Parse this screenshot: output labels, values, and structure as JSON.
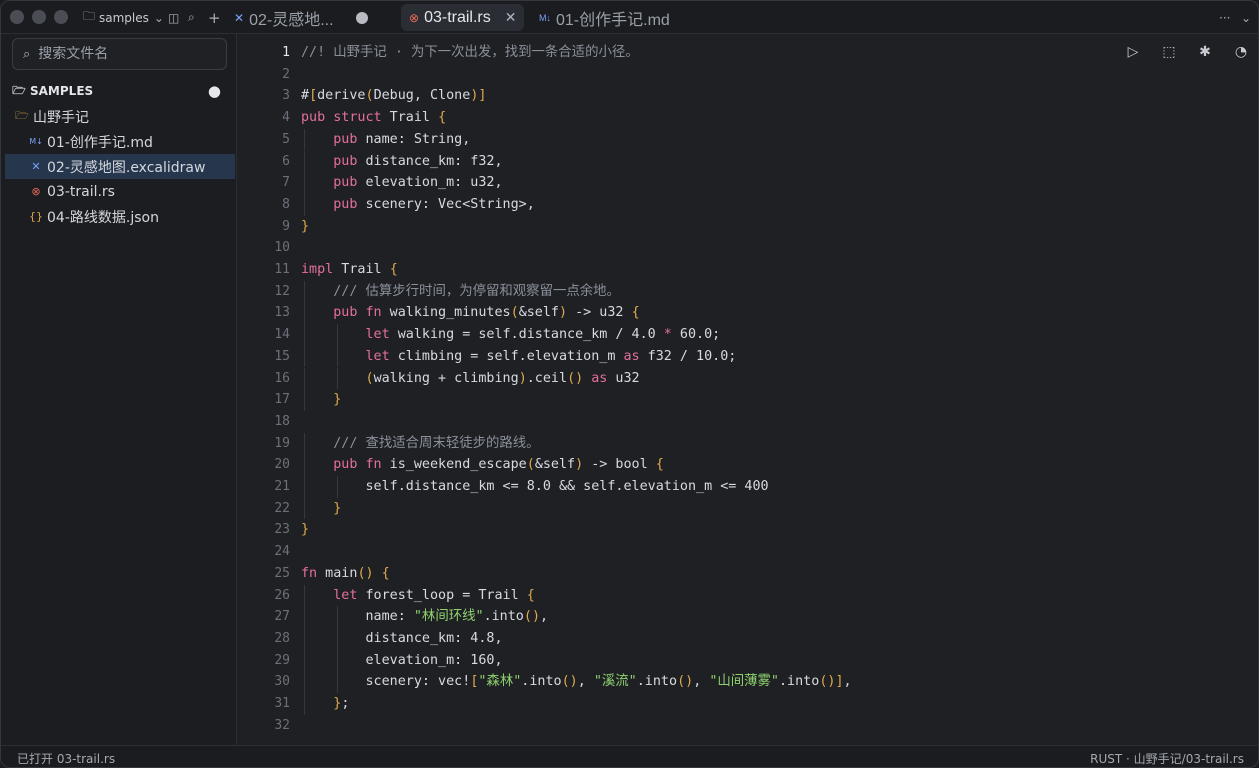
{
  "titlebar": {
    "workspace": "samples",
    "tabs": [
      {
        "label": "02-灵感地...",
        "icon": "excalidraw-icon",
        "active": false
      },
      {
        "label": "03-trail.rs",
        "icon": "rust-icon",
        "active": true
      },
      {
        "label": "01-创作手记.md",
        "icon": "markdown-icon",
        "active": false
      }
    ]
  },
  "sidebar": {
    "search_placeholder": "搜索文件名",
    "section_label": "SAMPLES",
    "folder": "山野手记",
    "files": [
      {
        "name": "01-创作手记.md",
        "icon": "markdown-icon"
      },
      {
        "name": "02-灵感地图.excalidraw",
        "icon": "excalidraw-icon",
        "selected": true
      },
      {
        "name": "03-trail.rs",
        "icon": "rust-icon"
      },
      {
        "name": "04-路线数据.json",
        "icon": "json-icon"
      }
    ]
  },
  "editor": {
    "current_line": 1,
    "lines": [
      "//! 山野手记 · 为下一次出发，找到一条合适的小径。",
      "",
      "#[derive(Debug, Clone)]",
      "pub struct Trail {",
      "    pub name: String,",
      "    pub distance_km: f32,",
      "    pub elevation_m: u32,",
      "    pub scenery: Vec<String>,",
      "}",
      "",
      "impl Trail {",
      "    /// 估算步行时间，为停留和观察留一点余地。",
      "    pub fn walking_minutes(&self) -> u32 {",
      "        let walking = self.distance_km / 4.0 * 60.0;",
      "        let climbing = self.elevation_m as f32 / 10.0;",
      "        (walking + climbing).ceil() as u32",
      "    }",
      "",
      "    /// 查找适合周末轻徒步的路线。",
      "    pub fn is_weekend_escape(&self) -> bool {",
      "        self.distance_km <= 8.0 && self.elevation_m <= 400",
      "    }",
      "}",
      "",
      "fn main() {",
      "    let forest_loop = Trail {",
      "        name: \"林间环线\".into(),",
      "        distance_km: 4.8,",
      "        elevation_m: 160,",
      "        scenery: vec![\"森林\".into(), \"溪流\".into(), \"山间薄雾\".into()],",
      "    };",
      ""
    ]
  },
  "statusbar": {
    "left": "已打开 03-trail.rs",
    "right": "RUST · 山野手记/03-trail.rs"
  }
}
